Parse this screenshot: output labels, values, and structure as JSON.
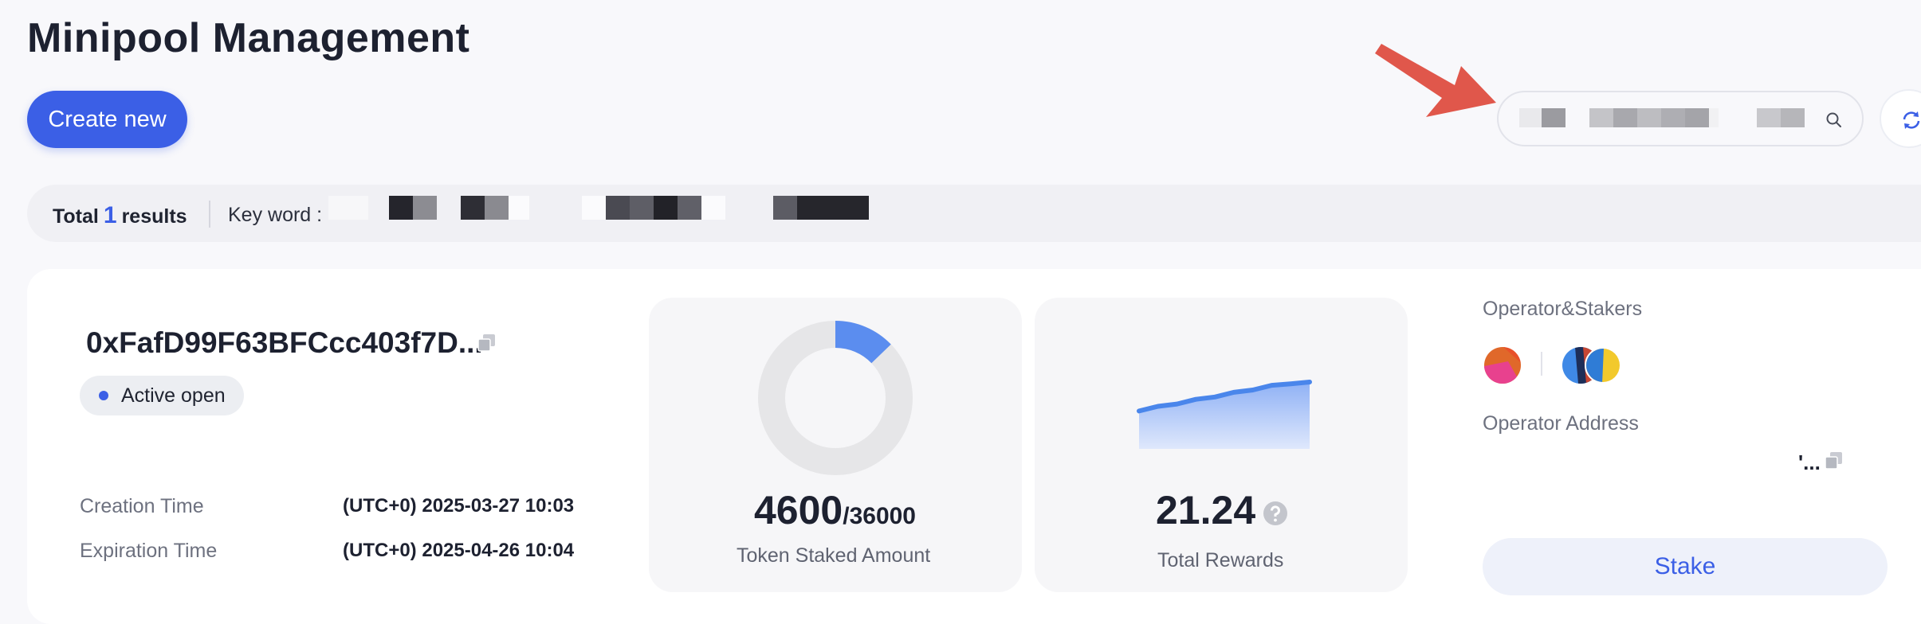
{
  "page": {
    "title": "Minipool Management"
  },
  "toolbar": {
    "create_label": "Create new"
  },
  "search": {
    "value": "",
    "icon": "search-icon"
  },
  "refresh": {
    "icon": "refresh-icon"
  },
  "results": {
    "total_prefix": "Total",
    "count": "1",
    "total_suffix": "results",
    "keyword_label": "Key word :",
    "keyword_value": ""
  },
  "minipool": {
    "address": "0xFafD99F63BFCcc403f7D...",
    "status": "Active open",
    "creation_label": "Creation Time",
    "creation_value": "(UTC+0) 2025-03-27 10:03",
    "expiration_label": "Expiration Time",
    "expiration_value": "(UTC+0) 2025-04-26 10:04",
    "staked": {
      "amount": "4600",
      "total": "/36000",
      "caption": "Token Staked Amount",
      "fraction": 0.1278
    },
    "rewards": {
      "amount": "21.24",
      "caption": "Total Rewards",
      "trend": [
        3,
        4,
        4.5,
        5.5,
        6,
        7,
        7.5,
        8.5,
        8.8,
        9.2
      ]
    },
    "operator_stakers_label": "Operator&Stakers",
    "operator_address_label": "Operator Address",
    "operator_address_value": "'...",
    "stake_label": "Stake"
  },
  "colors": {
    "accent": "#3b5fe6",
    "donut_fill": "#5b8def",
    "donut_track": "#e6e6e8",
    "arrow": "#e0574b"
  }
}
